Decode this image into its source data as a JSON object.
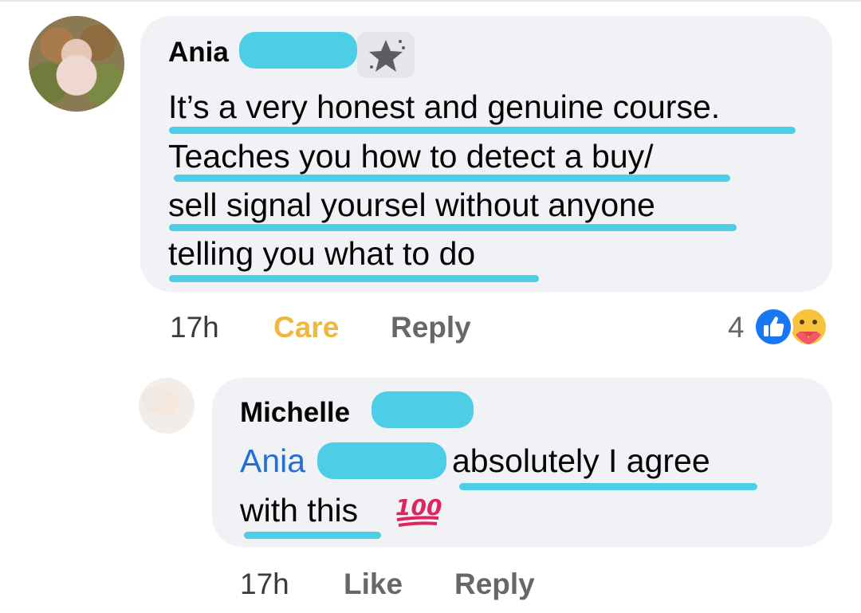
{
  "comment": {
    "author": "Ania",
    "lines": [
      "It’s a very honest and genuine course.",
      "Teaches you how  to detect a buy/",
      "sell signal yoursel without anyone",
      "telling you what to do"
    ],
    "time": "17h",
    "reaction_label": "Care",
    "reply_label": "Reply",
    "reaction_count": "4",
    "badge_icon": "star-badge-icon",
    "reaction_icons": [
      "like-icon",
      "care-icon"
    ]
  },
  "reply": {
    "author": "Michelle",
    "mention": "Ania",
    "text_line1": "absolutely I agree",
    "text_line2": "with this",
    "emoji": "hundred-points-icon",
    "time": "17h",
    "like_label": "Like",
    "reply_label": "Reply"
  },
  "colors": {
    "bubble": "#f0f2f5",
    "redaction": "#4ecee6",
    "mention": "#216fdb",
    "care": "#f0b73a",
    "secondary_text": "#65676b"
  }
}
